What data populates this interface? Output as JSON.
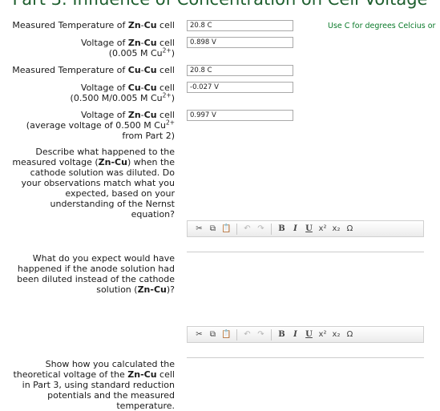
{
  "header": {
    "title": "Part 3. Influence of Concentration on Cell Voltage"
  },
  "hint": "Use C for degrees Celcius or",
  "rows": [
    {
      "pre": "Measured Temperature of ",
      "b1": "Zn",
      "mid": "-",
      "b2": "Cu",
      "post": " cell",
      "value": "20.8 C"
    },
    {
      "pre": "Voltage of ",
      "b1": "Zn",
      "mid": "-",
      "b2": "Cu",
      "post": " cell",
      "sub_pre": "(0.005 M Cu",
      "sub_sup": "2+",
      "sub_post": ")",
      "value": "0.898 V"
    },
    {
      "pre": "Measured Temperature of ",
      "b1": "Cu",
      "mid": "-",
      "b2": "Cu",
      "post": " cell",
      "value": "20.8 C"
    },
    {
      "pre": "Voltage of ",
      "b1": "Cu",
      "mid": "-",
      "b2": "Cu",
      "post": " cell",
      "sub_pre": "(0.500 M/0.005 M Cu",
      "sub_sup": "2+",
      "sub_post": ")",
      "value": "-0.027 V"
    },
    {
      "pre": "Voltage of ",
      "b1": "Zn",
      "mid": "-",
      "b2": "Cu",
      "post": " cell",
      "sub_pre": "(average voltage of 0.500 M Cu",
      "sub_sup": "2+",
      "sub_post": "",
      "sub2": "from Part 2)",
      "value": "0.997 V"
    }
  ],
  "questions": [
    {
      "text": "Describe what happened to the measured voltage (",
      "b": "Zn-Cu",
      "text2": ") when the cathode solution was diluted. Do your observations match what you expected, based on your understanding of the Nernst equation?"
    },
    {
      "text": "What do you expect would have happened if the anode solution had been diluted instead of the cathode solution (",
      "b": "Zn-Cu",
      "text2": ")?"
    },
    {
      "text": "Show how you calculated the theoretical voltage of the ",
      "b": "Zn-Cu",
      "text2": " cell in Part 3, using standard reduction potentials and the measured temperature."
    }
  ],
  "toolbar": {
    "cut": "✂",
    "copy": "⧉",
    "paste": "📋",
    "undo": "↶",
    "redo": "↷",
    "bold": "B",
    "italic": "I",
    "underline": "U",
    "superscript": "x²",
    "subscript": "x₂",
    "omega": "Ω"
  }
}
